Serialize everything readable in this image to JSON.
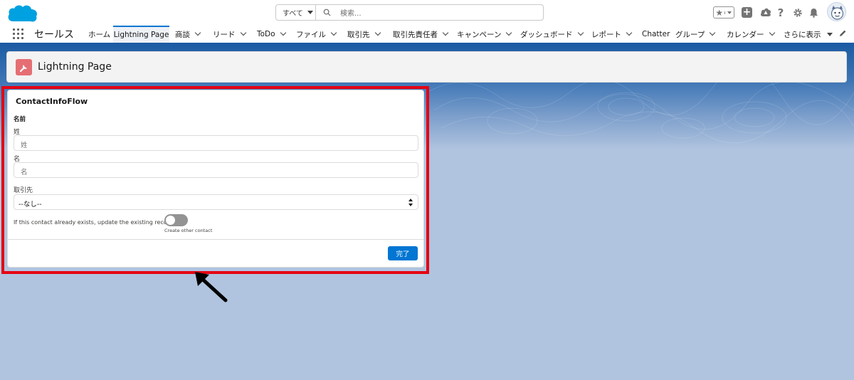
{
  "search": {
    "scope": "すべて",
    "placeholder": "検索..."
  },
  "nav": {
    "app_name": "セールス",
    "items": [
      {
        "label": "ホーム"
      },
      {
        "label": "Lightning Page"
      },
      {
        "label": "商談"
      },
      {
        "label": "リード"
      },
      {
        "label": "ToDo"
      },
      {
        "label": "ファイル"
      },
      {
        "label": "取引先"
      },
      {
        "label": "取引先責任者"
      },
      {
        "label": "キャンペーン"
      },
      {
        "label": "ダッシュボード"
      },
      {
        "label": "レポート"
      },
      {
        "label": "Chatter"
      },
      {
        "label": "グループ"
      },
      {
        "label": "カレンダー"
      },
      {
        "label": "さらに表示"
      }
    ]
  },
  "page_header": {
    "title": "Lightning Page"
  },
  "flow": {
    "title": "ContactInfoFlow",
    "name_section": "名前",
    "last_name": {
      "label": "姓",
      "placeholder": "姓"
    },
    "first_name": {
      "label": "名",
      "placeholder": "名"
    },
    "account": {
      "label": "取引先",
      "value": "--なし--"
    },
    "toggle": {
      "label": "If this contact already exists, update the existing record.",
      "state_label": "Create other contact",
      "on": false
    },
    "done_button": "完了"
  },
  "colors": {
    "brand": "#0176d3",
    "highlight": "#e60012",
    "page_icon": "#e56e74",
    "background": "#b0c4df"
  }
}
